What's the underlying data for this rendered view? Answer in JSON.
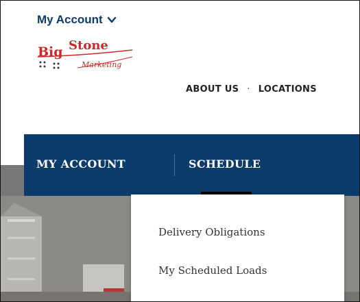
{
  "header": {
    "account_toggle_label": "My Account",
    "logo": {
      "word1": "Big",
      "word2": "Stone",
      "tagline": "Marketing"
    }
  },
  "top_nav": {
    "items": [
      {
        "label": "ABOUT US"
      },
      {
        "label": "LOCATIONS"
      }
    ],
    "separator": "·"
  },
  "main_nav": {
    "items": [
      {
        "label": "MY ACCOUNT"
      },
      {
        "label": "SCHEDULE"
      }
    ],
    "active": "SCHEDULE"
  },
  "schedule_menu": {
    "items": [
      {
        "label": "Delivery Obligations"
      },
      {
        "label": "My Scheduled Loads"
      }
    ]
  },
  "colors": {
    "brand_blue": "#0b3c6b",
    "brand_red": "#d0262a"
  },
  "icons": [
    "chevron-down-icon"
  ]
}
